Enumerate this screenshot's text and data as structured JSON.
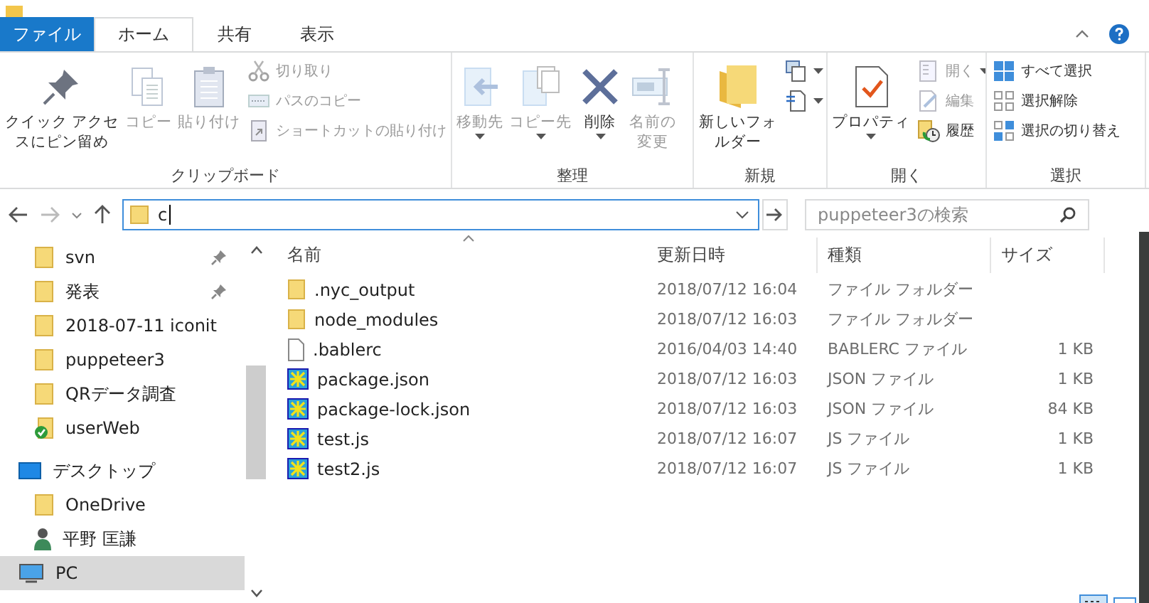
{
  "ribbon_tabs": [
    {
      "label": "ファイル",
      "kind": "file",
      "selected": false
    },
    {
      "label": "ホーム",
      "kind": "tab",
      "selected": true
    },
    {
      "label": "共有",
      "kind": "tab",
      "selected": false
    },
    {
      "label": "表示",
      "kind": "tab",
      "selected": false
    }
  ],
  "ribbon_groups": [
    {
      "label": "クリップボード",
      "buttons": [
        {
          "kind": "large",
          "label": "クイック アクセスにピン留め",
          "disabled": false,
          "dropdown": false
        },
        {
          "kind": "large",
          "label": "コピー",
          "disabled": true,
          "dropdown": false
        },
        {
          "kind": "large",
          "label": "貼り付け",
          "disabled": true,
          "dropdown": false
        },
        {
          "kind": "small",
          "label": "切り取り",
          "disabled": true,
          "dropdown": false
        },
        {
          "kind": "small",
          "label": "パスのコピー",
          "disabled": true,
          "dropdown": false
        },
        {
          "kind": "small",
          "label": "ショートカットの貼り付け",
          "disabled": true,
          "dropdown": false
        }
      ]
    },
    {
      "label": "整理",
      "buttons": [
        {
          "kind": "large",
          "label": "移動先",
          "disabled": true,
          "dropdown": true
        },
        {
          "kind": "large",
          "label": "コピー先",
          "disabled": true,
          "dropdown": true
        },
        {
          "kind": "large",
          "label": "削除",
          "disabled": false,
          "dropdown": true
        },
        {
          "kind": "large",
          "label": "名前の変更",
          "disabled": true,
          "dropdown": false
        }
      ]
    },
    {
      "label": "新規",
      "buttons": [
        {
          "kind": "large",
          "label": "新しいフォルダー",
          "disabled": false,
          "dropdown": false
        },
        {
          "kind": "small",
          "disabled": false,
          "dropdown": true
        },
        {
          "kind": "small",
          "disabled": false,
          "dropdown": true
        }
      ]
    },
    {
      "label": "開く",
      "buttons": [
        {
          "kind": "large",
          "label": "プロパティ",
          "disabled": false,
          "dropdown": true
        },
        {
          "kind": "small",
          "label": "開く",
          "disabled": true,
          "dropdown": true
        },
        {
          "kind": "small",
          "label": "編集",
          "disabled": true,
          "dropdown": false
        },
        {
          "kind": "small",
          "label": "履歴",
          "disabled": false,
          "dropdown": false
        }
      ]
    },
    {
      "label": "選択",
      "buttons": [
        {
          "kind": "small",
          "label": "すべて選択",
          "disabled": false,
          "dropdown": false
        },
        {
          "kind": "small",
          "label": "選択解除",
          "disabled": false,
          "dropdown": false
        },
        {
          "kind": "small",
          "label": "選択の切り替え",
          "disabled": false,
          "dropdown": false
        }
      ]
    }
  ],
  "address_bar": {
    "value": "c"
  },
  "search": {
    "placeholder": "puppeteer3の検索"
  },
  "sidebar": {
    "items": [
      {
        "label": "svn",
        "kind": "folder",
        "pinned": true,
        "selected": false
      },
      {
        "label": "発表",
        "kind": "folder",
        "pinned": true,
        "selected": false
      },
      {
        "label": "2018-07-11 iconit",
        "kind": "folder",
        "pinned": false,
        "selected": false
      },
      {
        "label": "puppeteer3",
        "kind": "folder",
        "pinned": false,
        "selected": false
      },
      {
        "label": "QRデータ調査",
        "kind": "folder",
        "pinned": false,
        "selected": false
      },
      {
        "label": "userWeb",
        "kind": "synced",
        "pinned": false,
        "selected": false
      },
      {
        "label": "デスクトップ",
        "kind": "desktop",
        "pinned": false,
        "selected": false,
        "children": [
          {
            "label": "OneDrive",
            "kind": "folder",
            "pinned": false,
            "selected": false
          },
          {
            "label": "平野 匡謙",
            "kind": "user",
            "pinned": false,
            "selected": false
          },
          {
            "label": "PC",
            "kind": "pc",
            "pinned": false,
            "selected": true
          }
        ]
      }
    ]
  },
  "table": {
    "columns": [
      "名前",
      "更新日時",
      "種類",
      "サイズ"
    ],
    "rows": [
      {
        "kind": "folder",
        "name": ".nyc_output",
        "modified": "2018/07/12 16:04",
        "type": "ファイル フォルダー"
      },
      {
        "kind": "folder",
        "name": "node_modules",
        "modified": "2018/07/12 16:03",
        "type": "ファイル フォルダー"
      },
      {
        "kind": "file",
        "name": ".bablerc",
        "modified": "2016/04/03 14:40",
        "type": "BABLERC ファイル",
        "size": "1 KB"
      },
      {
        "kind": "script",
        "name": "package.json",
        "modified": "2018/07/12 16:03",
        "type": "JSON ファイル",
        "size": "1 KB"
      },
      {
        "kind": "script",
        "name": "package-lock.json",
        "modified": "2018/07/12 16:03",
        "type": "JSON ファイル",
        "size": "84 KB"
      },
      {
        "kind": "script",
        "name": "test.js",
        "modified": "2018/07/12 16:07",
        "type": "JS ファイル",
        "size": "1 KB"
      },
      {
        "kind": "script",
        "name": "test2.js",
        "modified": "2018/07/12 16:07",
        "type": "JS ファイル",
        "size": "1 KB"
      }
    ]
  }
}
